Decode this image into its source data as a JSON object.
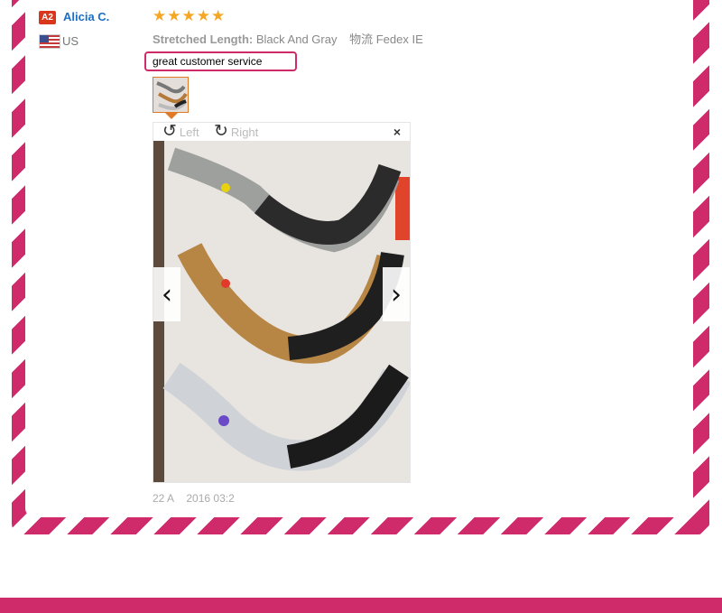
{
  "reviewer": {
    "level_badge": "A2",
    "name": "Alicia C.",
    "country": "US"
  },
  "review": {
    "rating_stars": 5,
    "attribute_label": "Stretched Length:",
    "attribute_value": "Black And Gray",
    "shipping_label": "物流",
    "shipping_value": "Fedex IE",
    "comment": "great customer service",
    "date": "22 A    2016 03:2"
  },
  "viewer": {
    "rotate_left_label": "Left",
    "rotate_right_label": "Right",
    "close_glyph": "×",
    "prev_glyph": "‹",
    "next_glyph": "›"
  },
  "colors": {
    "accent": "#cf2b6a",
    "star": "#f5a623",
    "name_link": "#1a6fc7",
    "thumb_border": "#e07a26"
  }
}
